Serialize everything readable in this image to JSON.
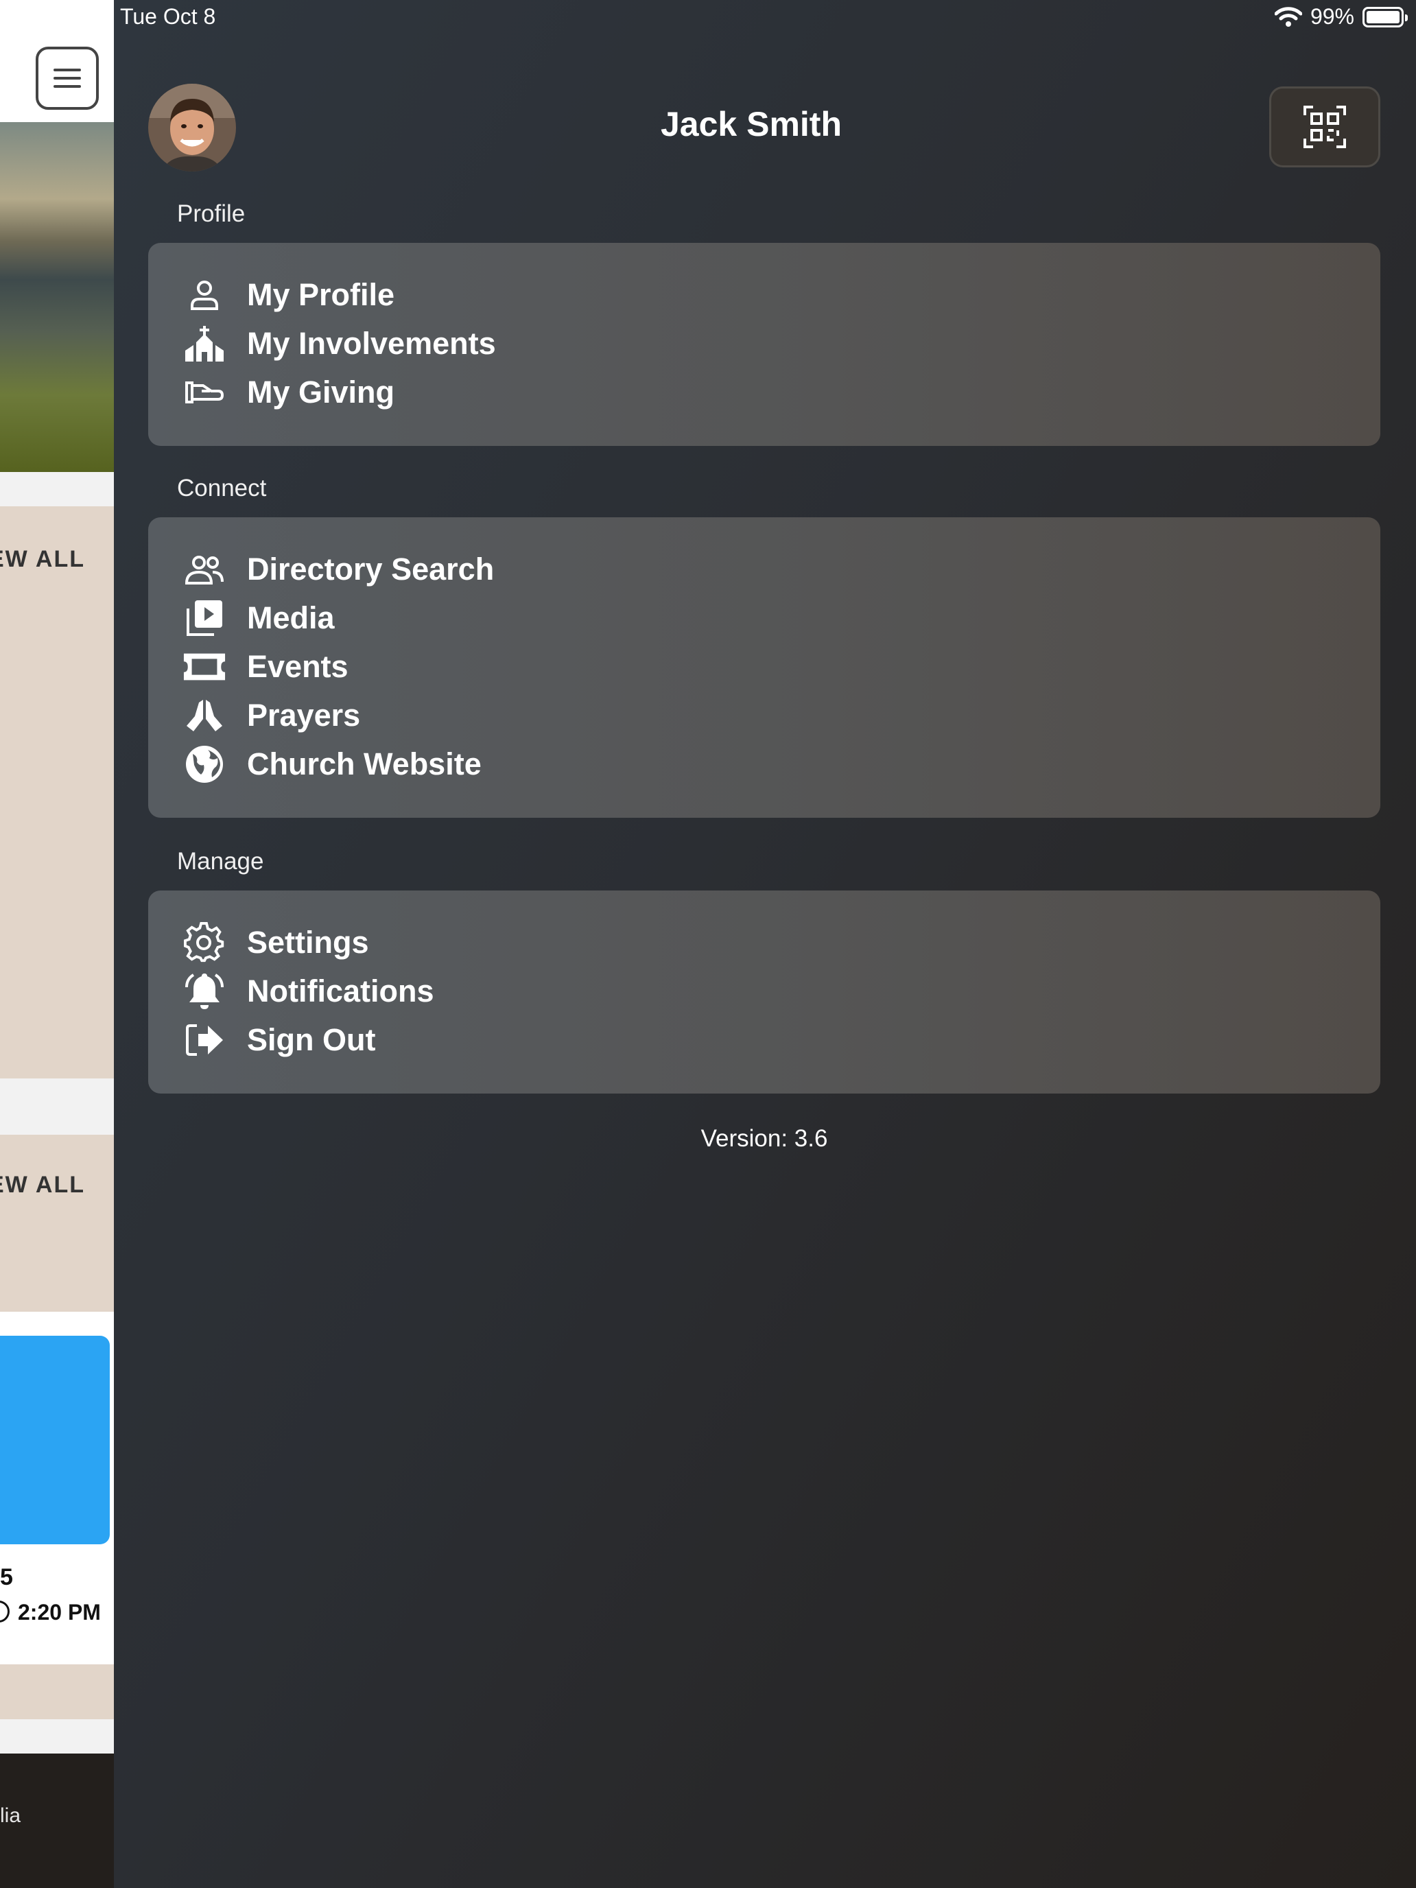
{
  "status_bar": {
    "date": "Tue Oct 8",
    "battery": "99%",
    "battery_level": 0.99
  },
  "background_page": {
    "view_all_1": "EW ALL",
    "view_all_2": "EW ALL",
    "event_date": "5",
    "event_time": "2:20 PM",
    "tab_label": "lia",
    "event_image_color": "#2ba4f3"
  },
  "drawer": {
    "user_name": "Jack Smith",
    "sections": [
      {
        "title": "Profile",
        "items": [
          {
            "label": "My Profile",
            "icon": "person-icon"
          },
          {
            "label": "My Involvements",
            "icon": "church-icon"
          },
          {
            "label": "My Giving",
            "icon": "giving-hand-icon"
          }
        ]
      },
      {
        "title": "Connect",
        "items": [
          {
            "label": "Directory Search",
            "icon": "people-icon"
          },
          {
            "label": "Media",
            "icon": "media-play-icon"
          },
          {
            "label": "Events",
            "icon": "ticket-icon"
          },
          {
            "label": "Prayers",
            "icon": "praying-hands-icon"
          },
          {
            "label": "Church Website",
            "icon": "globe-icon"
          }
        ]
      },
      {
        "title": "Manage",
        "items": [
          {
            "label": "Settings",
            "icon": "gear-icon"
          },
          {
            "label": "Notifications",
            "icon": "bell-icon"
          },
          {
            "label": "Sign Out",
            "icon": "sign-out-icon"
          }
        ]
      }
    ],
    "version": "Version: 3.6"
  }
}
